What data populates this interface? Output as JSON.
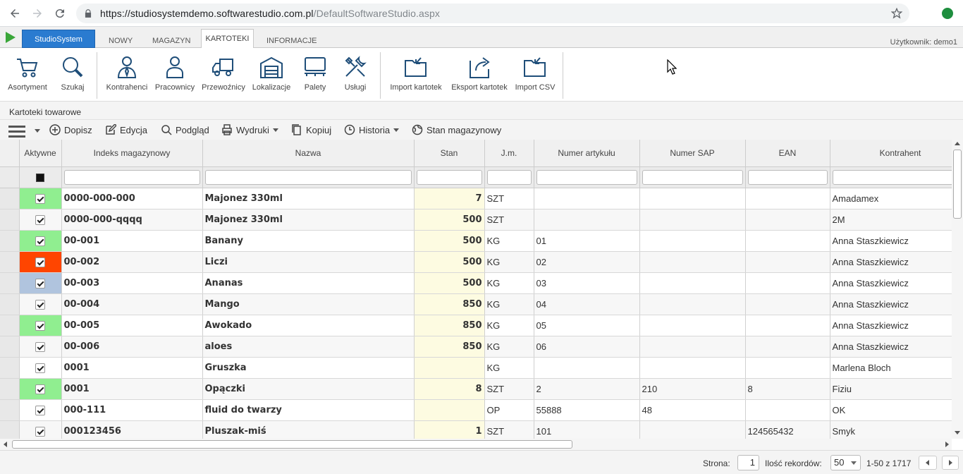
{
  "browser": {
    "url_host": "https://studiosystemdemo.softwarestudio.com.pl",
    "url_path": "/DefaultSoftwareStudio.aspx"
  },
  "app": {
    "main_tab": "StudioSystem",
    "tabs": [
      "NOWY",
      "MAGAZYN",
      "KARTOTEKI",
      "INFORMACJE"
    ],
    "active_tab": "KARTOTEKI",
    "user_label": "Użytkownik: demo1"
  },
  "ribbon": {
    "items": [
      {
        "label": "Asortyment",
        "icon": "cart-icon"
      },
      {
        "label": "Szukaj",
        "icon": "search-icon"
      },
      {
        "label": "Kontrahenci",
        "icon": "contractor-icon"
      },
      {
        "label": "Pracownicy",
        "icon": "employee-icon"
      },
      {
        "label": "Przewoźnicy",
        "icon": "truck-icon"
      },
      {
        "label": "Lokalizacje",
        "icon": "warehouse-icon"
      },
      {
        "label": "Palety",
        "icon": "pallet-icon"
      },
      {
        "label": "Usługi",
        "icon": "tools-icon"
      },
      {
        "label": "Import kartotek",
        "icon": "import-icon"
      },
      {
        "label": "Eksport kartotek",
        "icon": "export-icon"
      },
      {
        "label": "Import CSV",
        "icon": "import-csv-icon"
      }
    ]
  },
  "section_title": "Kartoteki towarowe",
  "toolbar": {
    "add": "Dopisz",
    "edit": "Edycja",
    "preview": "Podgląd",
    "print": "Wydruki",
    "copy": "Kopiuj",
    "history": "Historia",
    "stock": "Stan magazynowy"
  },
  "grid": {
    "columns": [
      "Aktywne",
      "Indeks magazynowy",
      "Nazwa",
      "Stan",
      "J.m.",
      "Numer artykułu",
      "Numer SAP",
      "EAN",
      "Kontrahent"
    ],
    "rows": [
      {
        "color": "green",
        "active": true,
        "index": "0000-000-000",
        "name": "Majonez 330ml",
        "stan": "7",
        "jm": "SZT",
        "art": "",
        "sap": "",
        "ean": "",
        "kontrahent": "Amadamex"
      },
      {
        "color": "",
        "active": true,
        "index": "0000-000-qqqq",
        "name": "Majonez 330ml",
        "stan": "500",
        "jm": "SZT",
        "art": "",
        "sap": "",
        "ean": "",
        "kontrahent": "2M"
      },
      {
        "color": "green",
        "active": true,
        "index": "00-001",
        "name": "Banany",
        "stan": "500",
        "jm": "KG",
        "art": "01",
        "sap": "",
        "ean": "",
        "kontrahent": "Anna Staszkiewicz"
      },
      {
        "color": "red",
        "active": true,
        "index": "00-002",
        "name": "Liczi",
        "stan": "500",
        "jm": "KG",
        "art": "02",
        "sap": "",
        "ean": "",
        "kontrahent": "Anna Staszkiewicz"
      },
      {
        "color": "blue",
        "active": true,
        "index": "00-003",
        "name": "Ananas",
        "stan": "500",
        "jm": "KG",
        "art": "03",
        "sap": "",
        "ean": "",
        "kontrahent": "Anna Staszkiewicz"
      },
      {
        "color": "",
        "active": true,
        "index": "00-004",
        "name": "Mango",
        "stan": "850",
        "jm": "KG",
        "art": "04",
        "sap": "",
        "ean": "",
        "kontrahent": "Anna Staszkiewicz"
      },
      {
        "color": "green",
        "active": true,
        "index": "00-005",
        "name": "Awokado",
        "stan": "850",
        "jm": "KG",
        "art": "05",
        "sap": "",
        "ean": "",
        "kontrahent": "Anna Staszkiewicz"
      },
      {
        "color": "",
        "active": true,
        "index": "00-006",
        "name": "aloes",
        "stan": "850",
        "jm": "KG",
        "art": "06",
        "sap": "",
        "ean": "",
        "kontrahent": "Anna Staszkiewicz"
      },
      {
        "color": "",
        "active": true,
        "index": "0001",
        "name": "Gruszka",
        "stan": "",
        "jm": "KG",
        "art": "",
        "sap": "",
        "ean": "",
        "kontrahent": "Marlena Bloch"
      },
      {
        "color": "green",
        "active": true,
        "index": "0001",
        "name": "Opączki",
        "stan": "8",
        "jm": "SZT",
        "art": "2",
        "sap": "210",
        "ean": "8",
        "kontrahent": "Fiziu"
      },
      {
        "color": "",
        "active": true,
        "index": "000-111",
        "name": "fluid do twarzy",
        "stan": "",
        "jm": "OP",
        "art": "55888",
        "sap": "48",
        "ean": "",
        "kontrahent": "OK"
      },
      {
        "color": "",
        "active": true,
        "index": "000123456",
        "name": "Pluszak-miś",
        "stan": "1",
        "jm": "SZT",
        "art": "101",
        "sap": "",
        "ean": "124565432",
        "kontrahent": "Smyk"
      }
    ]
  },
  "pager": {
    "page_label": "Strona:",
    "page_value": "1",
    "records_label": "Ilość rekordów:",
    "records_value": "50",
    "range_text": "1-50 z 1717"
  }
}
